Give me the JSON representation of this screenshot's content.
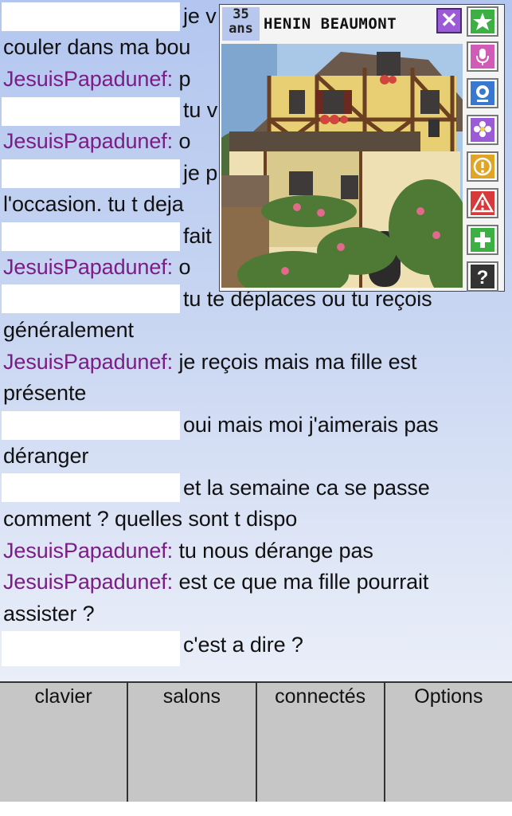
{
  "chat": {
    "lines": [
      {
        "nick": "",
        "text": "je v"
      },
      {
        "nick": "",
        "text": "couler dans ma bou"
      },
      {
        "nick": "JesuisPapadunef:",
        "text": " p"
      },
      {
        "nick": "",
        "text": "tu v"
      },
      {
        "nick": "JesuisPapadunef:",
        "text": " o"
      },
      {
        "nick": "",
        "text": "je p"
      },
      {
        "nick": "",
        "text": "l'occasion. tu t deja"
      },
      {
        "nick": "",
        "text": "fait"
      },
      {
        "nick": "JesuisPapadunef:",
        "text": " o"
      },
      {
        "nick": "",
        "text": "tu te déplaces ou tu reçois"
      },
      {
        "nick": "",
        "text": "généralement"
      },
      {
        "nick": "JesuisPapadunef:",
        "text": " je reçois mais ma fille est"
      },
      {
        "nick": "",
        "text": "présente"
      },
      {
        "nick": "",
        "text": "oui mais moi j'aimerais pas"
      },
      {
        "nick": "",
        "text": "déranger"
      },
      {
        "nick": "",
        "text": "et la semaine ca se passe"
      },
      {
        "nick": "",
        "text": "comment ? quelles sont t dispo"
      },
      {
        "nick": "JesuisPapadunef:",
        "text": " tu nous dérange pas"
      },
      {
        "nick": "JesuisPapadunef:",
        "text": " est ce que ma fille pourrait"
      },
      {
        "nick": "",
        "text": "assister ?"
      },
      {
        "nick": "",
        "text": "c'est a dire ?"
      }
    ]
  },
  "profile": {
    "age_number": "35",
    "age_unit": "ans",
    "city": "HENIN BEAUMONT",
    "close_symbol": "✕",
    "actions": [
      {
        "icon": "star-icon",
        "color": "#3cb043"
      },
      {
        "icon": "microphone-icon",
        "color": "#d05cb8"
      },
      {
        "icon": "webcam-icon",
        "color": "#3a78d0"
      },
      {
        "icon": "flower-icon",
        "color": "#9b5ad6"
      },
      {
        "icon": "alert-circle-icon",
        "color": "#e0a526"
      },
      {
        "icon": "warning-icon",
        "color": "#d63a3a"
      },
      {
        "icon": "plus-icon",
        "color": "#3cb043"
      },
      {
        "icon": "help-icon",
        "color": "#333333"
      }
    ]
  },
  "bottom_nav": {
    "clavier": "clavier",
    "salons": "salons",
    "connectes": "connectés",
    "options": "Options"
  }
}
